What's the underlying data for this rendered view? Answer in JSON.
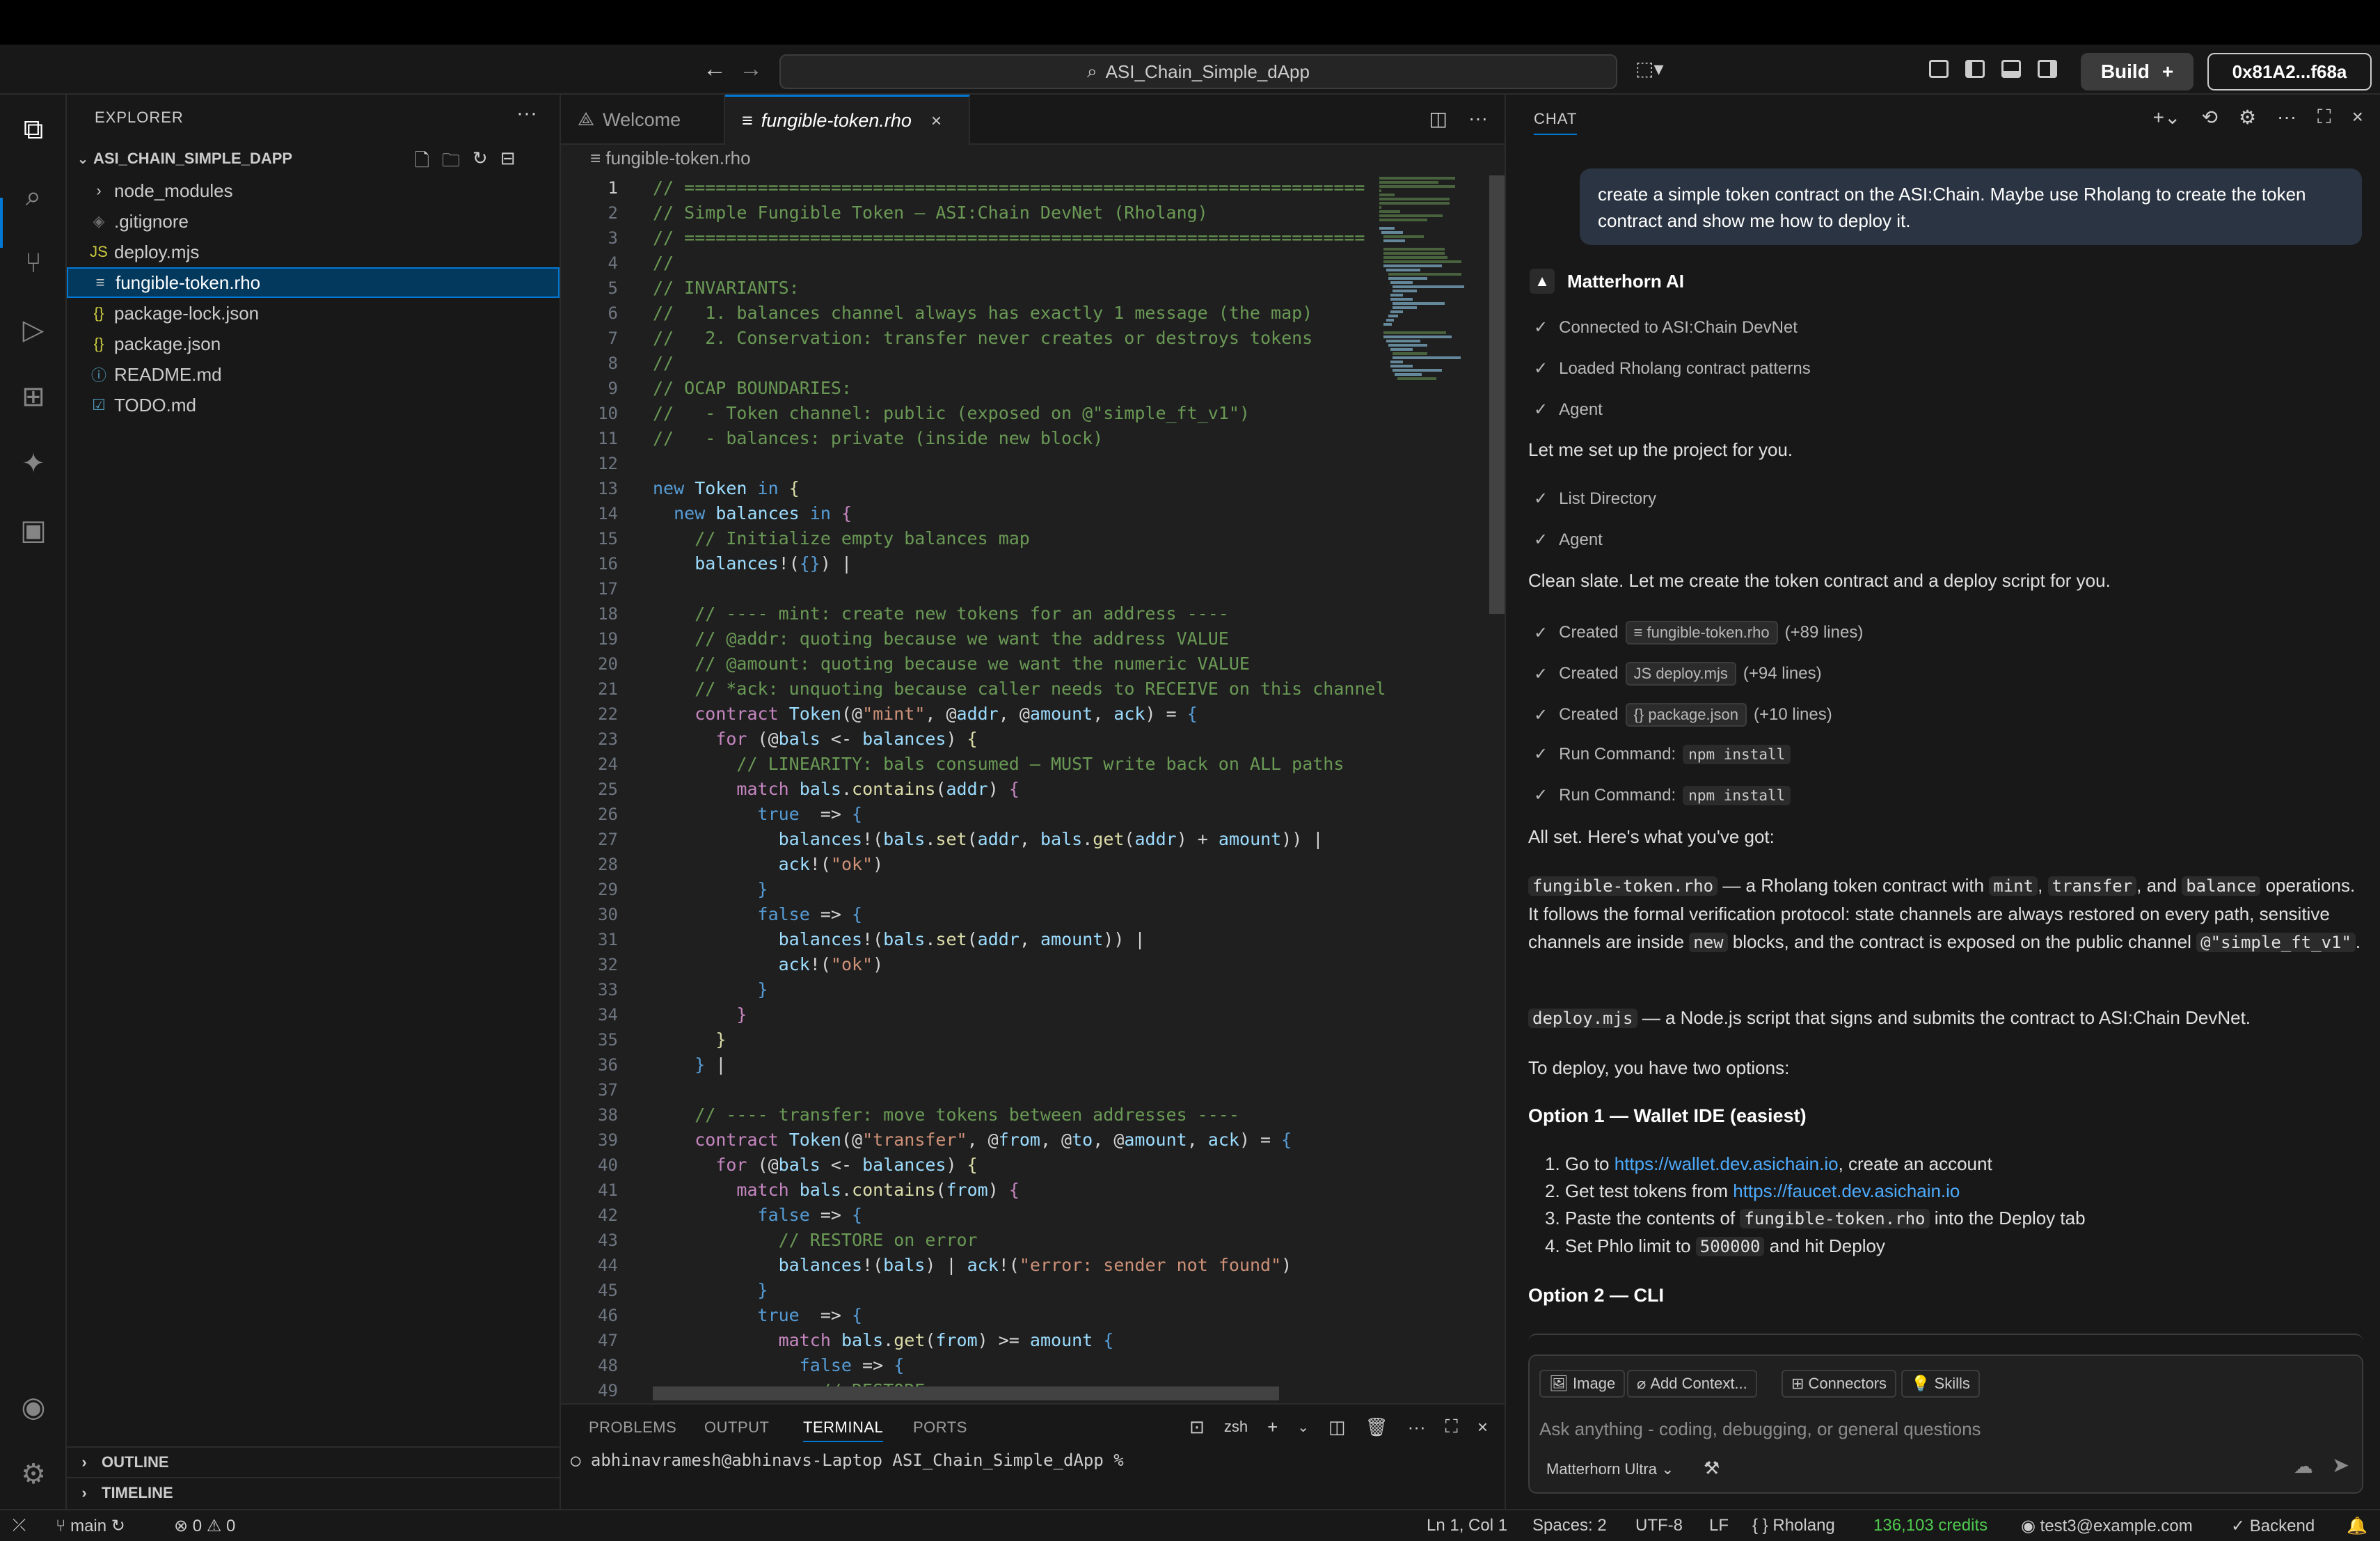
{
  "titlebar": {
    "search_text": "ASI_Chain_Simple_dApp",
    "build_label": "Build",
    "build_plus": "+",
    "wallet": "0x81A2...f68a"
  },
  "explorer": {
    "title": "EXPLORER",
    "project": "ASI_CHAIN_SIMPLE_DAPP",
    "items": [
      {
        "icon": "›",
        "label": "node_modules",
        "selected": false,
        "color": "#cccccc"
      },
      {
        "icon": "◈",
        "label": ".gitignore",
        "selected": false,
        "color": "#6d6d6d"
      },
      {
        "icon": "JS",
        "label": "deploy.mjs",
        "selected": false,
        "color": "#cbcb41"
      },
      {
        "icon": "≡",
        "label": "fungible-token.rho",
        "selected": true,
        "color": "#cccccc"
      },
      {
        "icon": "{}",
        "label": "package-lock.json",
        "selected": false,
        "color": "#cbcb41"
      },
      {
        "icon": "{}",
        "label": "package.json",
        "selected": false,
        "color": "#cbcb41"
      },
      {
        "icon": "ⓘ",
        "label": "README.md",
        "selected": false,
        "color": "#519aba"
      },
      {
        "icon": "☑",
        "label": "TODO.md",
        "selected": false,
        "color": "#519aba"
      }
    ],
    "outline": "OUTLINE",
    "timeline": "TIMELINE"
  },
  "editor": {
    "tabs": [
      {
        "label": "Welcome",
        "active": false
      },
      {
        "label": "fungible-token.rho",
        "active": true
      }
    ],
    "breadcrumb": "fungible-token.rho",
    "lines": [
      [
        [
          "c-com",
          "// ================================================================="
        ]
      ],
      [
        [
          "c-com",
          "// Simple Fungible Token — ASI:Chain DevNet (Rholang)"
        ]
      ],
      [
        [
          "c-com",
          "// ================================================================="
        ]
      ],
      [
        [
          "c-com",
          "//"
        ]
      ],
      [
        [
          "c-com",
          "// INVARIANTS:"
        ]
      ],
      [
        [
          "c-com",
          "//   1. balances channel always has exactly 1 message (the map)"
        ]
      ],
      [
        [
          "c-com",
          "//   2. Conservation: transfer never creates or destroys tokens"
        ]
      ],
      [
        [
          "c-com",
          "//"
        ]
      ],
      [
        [
          "c-com",
          "// OCAP BOUNDARIES:"
        ]
      ],
      [
        [
          "c-com",
          "//   - Token channel: public (exposed on @\"simple_ft_v1\")"
        ]
      ],
      [
        [
          "c-com",
          "//   - balances: private (inside new block)"
        ]
      ],
      [
        [
          "c-pl",
          ""
        ]
      ],
      [
        [
          "c-kw",
          "new "
        ],
        [
          "c-id",
          "Token "
        ],
        [
          "c-kw",
          "in "
        ],
        [
          "c-fn",
          "{"
        ]
      ],
      [
        [
          "c-pl",
          "  "
        ],
        [
          "c-kw",
          "new "
        ],
        [
          "c-id",
          "balances "
        ],
        [
          "c-kw",
          "in "
        ],
        [
          "c-kw2",
          "{"
        ]
      ],
      [
        [
          "c-pl",
          "    "
        ],
        [
          "c-com",
          "// Initialize empty balances map"
        ]
      ],
      [
        [
          "c-pl",
          "    "
        ],
        [
          "c-id",
          "balances"
        ],
        [
          "c-pl",
          "!("
        ],
        [
          "c-kw",
          "{}"
        ],
        [
          "c-pl",
          ") |"
        ]
      ],
      [
        [
          "c-pl",
          ""
        ]
      ],
      [
        [
          "c-pl",
          "    "
        ],
        [
          "c-com",
          "// ---- mint: create new tokens for an address ----"
        ]
      ],
      [
        [
          "c-pl",
          "    "
        ],
        [
          "c-com",
          "// @addr: quoting because we want the address VALUE"
        ]
      ],
      [
        [
          "c-pl",
          "    "
        ],
        [
          "c-com",
          "// @amount: quoting because we want the numeric VALUE"
        ]
      ],
      [
        [
          "c-pl",
          "    "
        ],
        [
          "c-com",
          "// *ack: unquoting because caller needs to RECEIVE on this channel"
        ]
      ],
      [
        [
          "c-pl",
          "    "
        ],
        [
          "c-kw2",
          "contract "
        ],
        [
          "c-id",
          "Token"
        ],
        [
          "c-pl",
          "(@"
        ],
        [
          "c-str",
          "\"mint\""
        ],
        [
          "c-pl",
          ", @"
        ],
        [
          "c-id",
          "addr"
        ],
        [
          "c-pl",
          ", @"
        ],
        [
          "c-id",
          "amount"
        ],
        [
          "c-pl",
          ", "
        ],
        [
          "c-id",
          "ack"
        ],
        [
          "c-pl",
          ") = "
        ],
        [
          "c-kw",
          "{"
        ]
      ],
      [
        [
          "c-pl",
          "      "
        ],
        [
          "c-kw2",
          "for "
        ],
        [
          "c-pl",
          "(@"
        ],
        [
          "c-id",
          "bals "
        ],
        [
          "c-pl",
          "<- "
        ],
        [
          "c-id",
          "balances"
        ],
        [
          "c-pl",
          ") "
        ],
        [
          "c-fn",
          "{"
        ]
      ],
      [
        [
          "c-pl",
          "        "
        ],
        [
          "c-com",
          "// LINEARITY: bals consumed — MUST write back on ALL paths"
        ]
      ],
      [
        [
          "c-pl",
          "        "
        ],
        [
          "c-kw2",
          "match "
        ],
        [
          "c-id",
          "bals"
        ],
        [
          "c-pl",
          "."
        ],
        [
          "c-fn",
          "contains"
        ],
        [
          "c-pl",
          "("
        ],
        [
          "c-id",
          "addr"
        ],
        [
          "c-pl",
          ") "
        ],
        [
          "c-kw2",
          "{"
        ]
      ],
      [
        [
          "c-pl",
          "          "
        ],
        [
          "c-kw",
          "true  "
        ],
        [
          "c-pl",
          "=> "
        ],
        [
          "c-kw",
          "{"
        ]
      ],
      [
        [
          "c-pl",
          "            "
        ],
        [
          "c-id",
          "balances"
        ],
        [
          "c-pl",
          "!("
        ],
        [
          "c-id",
          "bals"
        ],
        [
          "c-pl",
          "."
        ],
        [
          "c-fn",
          "set"
        ],
        [
          "c-pl",
          "("
        ],
        [
          "c-id",
          "addr"
        ],
        [
          "c-pl",
          ", "
        ],
        [
          "c-id",
          "bals"
        ],
        [
          "c-pl",
          "."
        ],
        [
          "c-fn",
          "get"
        ],
        [
          "c-pl",
          "("
        ],
        [
          "c-id",
          "addr"
        ],
        [
          "c-pl",
          ") + "
        ],
        [
          "c-id",
          "amount"
        ],
        [
          "c-pl",
          ")) |"
        ]
      ],
      [
        [
          "c-pl",
          "            "
        ],
        [
          "c-id",
          "ack"
        ],
        [
          "c-pl",
          "!("
        ],
        [
          "c-str",
          "\"ok\""
        ],
        [
          "c-pl",
          ")"
        ]
      ],
      [
        [
          "c-pl",
          "          "
        ],
        [
          "c-kw",
          "}"
        ]
      ],
      [
        [
          "c-pl",
          "          "
        ],
        [
          "c-kw",
          "false "
        ],
        [
          "c-pl",
          "=> "
        ],
        [
          "c-kw",
          "{"
        ]
      ],
      [
        [
          "c-pl",
          "            "
        ],
        [
          "c-id",
          "balances"
        ],
        [
          "c-pl",
          "!("
        ],
        [
          "c-id",
          "bals"
        ],
        [
          "c-pl",
          "."
        ],
        [
          "c-fn",
          "set"
        ],
        [
          "c-pl",
          "("
        ],
        [
          "c-id",
          "addr"
        ],
        [
          "c-pl",
          ", "
        ],
        [
          "c-id",
          "amount"
        ],
        [
          "c-pl",
          ")) |"
        ]
      ],
      [
        [
          "c-pl",
          "            "
        ],
        [
          "c-id",
          "ack"
        ],
        [
          "c-pl",
          "!("
        ],
        [
          "c-str",
          "\"ok\""
        ],
        [
          "c-pl",
          ")"
        ]
      ],
      [
        [
          "c-pl",
          "          "
        ],
        [
          "c-kw",
          "}"
        ]
      ],
      [
        [
          "c-pl",
          "        "
        ],
        [
          "c-kw2",
          "}"
        ]
      ],
      [
        [
          "c-pl",
          "      "
        ],
        [
          "c-fn",
          "}"
        ]
      ],
      [
        [
          "c-pl",
          "    "
        ],
        [
          "c-kw",
          "}"
        ],
        [
          "c-pl",
          " |"
        ]
      ],
      [
        [
          "c-pl",
          ""
        ]
      ],
      [
        [
          "c-pl",
          "    "
        ],
        [
          "c-com",
          "// ---- transfer: move tokens between addresses ----"
        ]
      ],
      [
        [
          "c-pl",
          "    "
        ],
        [
          "c-kw2",
          "contract "
        ],
        [
          "c-id",
          "Token"
        ],
        [
          "c-pl",
          "(@"
        ],
        [
          "c-str",
          "\"transfer\""
        ],
        [
          "c-pl",
          ", @"
        ],
        [
          "c-id",
          "from"
        ],
        [
          "c-pl",
          ", @"
        ],
        [
          "c-id",
          "to"
        ],
        [
          "c-pl",
          ", @"
        ],
        [
          "c-id",
          "amount"
        ],
        [
          "c-pl",
          ", "
        ],
        [
          "c-id",
          "ack"
        ],
        [
          "c-pl",
          ") = "
        ],
        [
          "c-kw",
          "{"
        ]
      ],
      [
        [
          "c-pl",
          "      "
        ],
        [
          "c-kw2",
          "for "
        ],
        [
          "c-pl",
          "(@"
        ],
        [
          "c-id",
          "bals "
        ],
        [
          "c-pl",
          "<- "
        ],
        [
          "c-id",
          "balances"
        ],
        [
          "c-pl",
          ") "
        ],
        [
          "c-fn",
          "{"
        ]
      ],
      [
        [
          "c-pl",
          "        "
        ],
        [
          "c-kw2",
          "match "
        ],
        [
          "c-id",
          "bals"
        ],
        [
          "c-pl",
          "."
        ],
        [
          "c-fn",
          "contains"
        ],
        [
          "c-pl",
          "("
        ],
        [
          "c-id",
          "from"
        ],
        [
          "c-pl",
          ") "
        ],
        [
          "c-kw2",
          "{"
        ]
      ],
      [
        [
          "c-pl",
          "          "
        ],
        [
          "c-kw",
          "false "
        ],
        [
          "c-pl",
          "=> "
        ],
        [
          "c-kw",
          "{"
        ]
      ],
      [
        [
          "c-pl",
          "            "
        ],
        [
          "c-com",
          "// RESTORE on error"
        ]
      ],
      [
        [
          "c-pl",
          "            "
        ],
        [
          "c-id",
          "balances"
        ],
        [
          "c-pl",
          "!("
        ],
        [
          "c-id",
          "bals"
        ],
        [
          "c-pl",
          ") | "
        ],
        [
          "c-id",
          "ack"
        ],
        [
          "c-pl",
          "!("
        ],
        [
          "c-str",
          "\"error: sender not found\""
        ],
        [
          "c-pl",
          ")"
        ]
      ],
      [
        [
          "c-pl",
          "          "
        ],
        [
          "c-kw",
          "}"
        ]
      ],
      [
        [
          "c-pl",
          "          "
        ],
        [
          "c-kw",
          "true  "
        ],
        [
          "c-pl",
          "=> "
        ],
        [
          "c-kw",
          "{"
        ]
      ],
      [
        [
          "c-pl",
          "            "
        ],
        [
          "c-kw2",
          "match "
        ],
        [
          "c-id",
          "bals"
        ],
        [
          "c-pl",
          "."
        ],
        [
          "c-fn",
          "get"
        ],
        [
          "c-pl",
          "("
        ],
        [
          "c-id",
          "from"
        ],
        [
          "c-pl",
          ") >= "
        ],
        [
          "c-id",
          "amount "
        ],
        [
          "c-kw",
          "{"
        ]
      ],
      [
        [
          "c-pl",
          "              "
        ],
        [
          "c-kw",
          "false "
        ],
        [
          "c-pl",
          "=> "
        ],
        [
          "c-kw",
          "{"
        ]
      ],
      [
        [
          "c-pl",
          "                "
        ],
        [
          "c-com",
          "// RESTORE on error"
        ]
      ]
    ]
  },
  "panel": {
    "tabs": [
      "PROBLEMS",
      "OUTPUT",
      "TERMINAL",
      "PORTS"
    ],
    "active": "TERMINAL",
    "shell": "zsh",
    "prompt": "abhinavramesh@abhinavs-Laptop ASI_Chain_Simple_dApp %"
  },
  "chat": {
    "title": "CHAT",
    "user_message": "create a simple token contract on the ASI:Chain. Maybe use Rholang to create the token contract and show me how to deploy it.",
    "assistant_name": "Matterhorn AI",
    "steps1": [
      "Connected to ASI:Chain DevNet",
      "Loaded Rholang contract patterns",
      "Agent"
    ],
    "para1": "Let me set up the project for you.",
    "steps2": [
      "List Directory",
      "Agent"
    ],
    "para2": "Clean slate. Let me create the token contract and a deploy script for you.",
    "created": [
      {
        "label": "Created",
        "file": "fungible-token.rho",
        "lines": "(+89 lines)",
        "icon": "≡"
      },
      {
        "label": "Created",
        "file": "deploy.mjs",
        "lines": "(+94 lines)",
        "icon": "JS"
      },
      {
        "label": "Created",
        "file": "package.json",
        "lines": "(+10 lines)",
        "icon": "{}"
      }
    ],
    "commands": [
      {
        "label": "Run Command:",
        "cmd": "npm install"
      },
      {
        "label": "Run Command:",
        "cmd": "npm install"
      }
    ],
    "para3": "All set. Here's what you've got:",
    "desc1": {
      "code1": "fungible-token.rho",
      "t1": " — a Rholang token contract with ",
      "code2": "mint",
      "t2": ", ",
      "code3": "transfer",
      "t3": ", and ",
      "code4": "balance",
      "t4": " operations. It follows the formal verification protocol: state channels are always restored on every path, sensitive channels are inside ",
      "code5": "new",
      "t5": " blocks, and the contract is exposed on the public channel ",
      "code6": "@\"simple_ft_v1\"",
      "t6": "."
    },
    "desc2": {
      "code": "deploy.mjs",
      "text": " — a Node.js script that signs and submits the contract to ASI:Chain DevNet."
    },
    "para4": "To deploy, you have two options:",
    "option1": "Option 1 — Wallet IDE (easiest)",
    "opt1_items": {
      "i1_pre": "Go to ",
      "i1_link": "https://wallet.dev.asichain.io",
      "i1_post": ", create an account",
      "i2_pre": "Get test tokens from ",
      "i2_link": "https://faucet.dev.asichain.io",
      "i3_pre": "Paste the contents of ",
      "i3_code": "fungible-token.rho",
      "i3_post": " into the Deploy tab",
      "i4_pre": "Set Phlo limit to ",
      "i4_code": "500000",
      "i4_post": " and hit Deploy"
    },
    "option2": "Option 2 — CLI",
    "input": {
      "image": "Image",
      "context": "Add Context...",
      "connectors": "Connectors",
      "skills": "Skills",
      "placeholder": "Ask anything - coding, debugging, or general questions",
      "model": "Matterhorn Ultra"
    }
  },
  "status": {
    "branch": "main",
    "errors": "0",
    "warnings": "0",
    "position": "Ln 1, Col 1",
    "spaces": "Spaces: 2",
    "encoding": "UTF-8",
    "eol": "LF",
    "language": "Rholang",
    "credits": "136,103 credits",
    "account": "test3@example.com",
    "backend": "Backend"
  }
}
